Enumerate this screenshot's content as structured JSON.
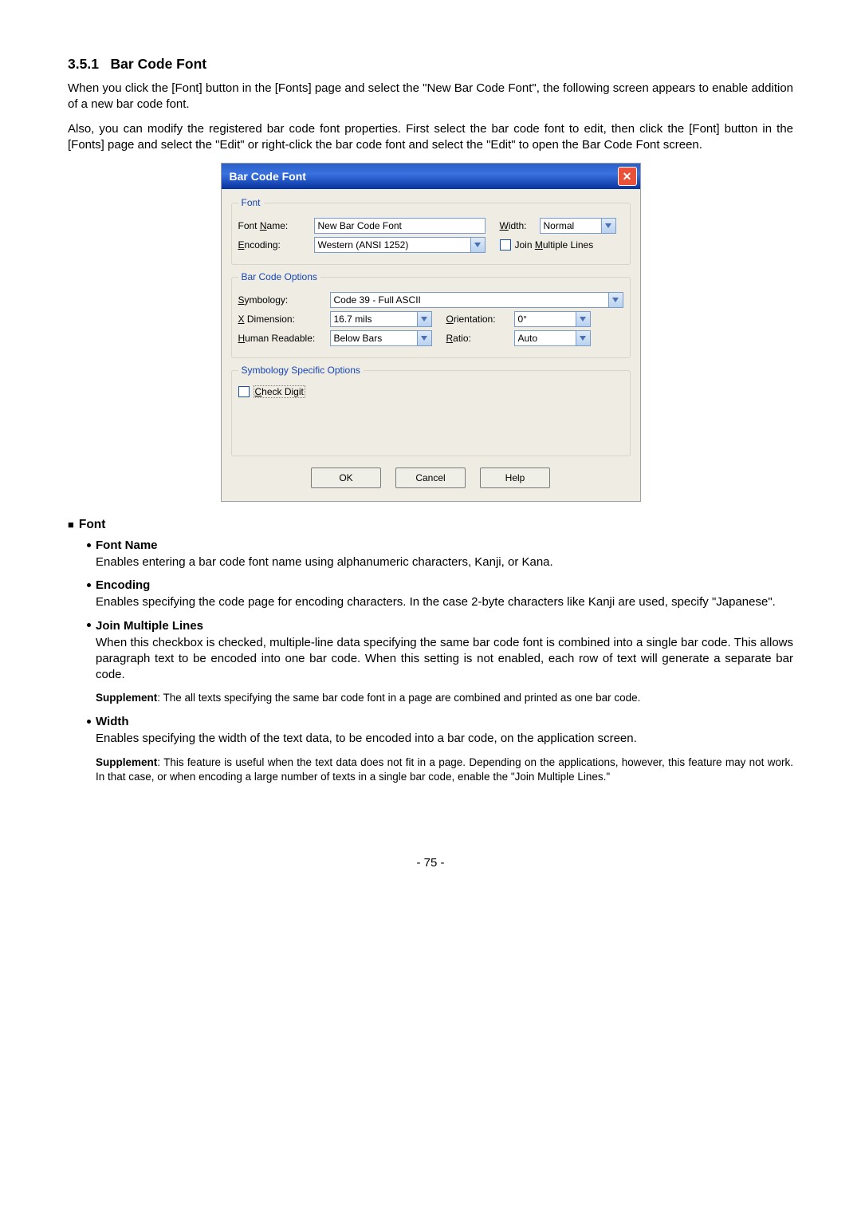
{
  "section_number": "3.5.1",
  "section_title": "Bar Code Font",
  "intro_p1": "When you click the [Font] button in the [Fonts] page and select the \"New Bar Code Font\", the following screen appears to enable addition of a new bar code font.",
  "intro_p2": "Also, you can modify the registered bar code font properties.   First select the bar code font to edit, then click the [Font] button in the [Fonts] page and select the \"Edit\" or right-click the bar code font and select the \"Edit\" to open the Bar Code Font screen.",
  "dialog": {
    "title": "Bar Code Font",
    "group_font_legend": "Font",
    "font_name_lbl_pre": "Font ",
    "font_name_lbl_u": "N",
    "font_name_lbl_post": "ame:",
    "font_name_val": "New Bar Code Font",
    "width_lbl_u": "W",
    "width_lbl_post": "idth:",
    "width_val": "Normal",
    "encoding_lbl_u": "E",
    "encoding_lbl_post": "ncoding:",
    "encoding_val": "Western (ANSI 1252)",
    "join_lbl_pre": "Join ",
    "join_lbl_u": "M",
    "join_lbl_post": "ultiple Lines",
    "group_bco_legend": "Bar Code Options",
    "symb_lbl_u": "S",
    "symb_lbl_post": "ymbology:",
    "symb_val": "Code 39 - Full ASCII",
    "xdim_lbl_u": "X",
    "xdim_lbl_post": " Dimension:",
    "xdim_val": "16.7 mils",
    "orient_lbl_u": "O",
    "orient_lbl_post": "rientation:",
    "orient_val": "0°",
    "hr_lbl_u": "H",
    "hr_lbl_post": "uman Readable:",
    "hr_val": "Below Bars",
    "ratio_lbl_u": "R",
    "ratio_lbl_post": "atio:",
    "ratio_val": "Auto",
    "group_sso_legend": "Symbology Specific Options",
    "check_lbl_u": "C",
    "check_lbl_post": "heck Digit",
    "btn_ok": "OK",
    "btn_cancel": "Cancel",
    "btn_help": "Help"
  },
  "body": {
    "sect_font": "Font",
    "fn_hdr": "Font Name",
    "fn_txt": "Enables entering a bar code font name using alphanumeric characters, Kanji, or Kana.",
    "enc_hdr": "Encoding",
    "enc_txt": "Enables specifying the code page for encoding characters.  In the case 2-byte characters like Kanji are used, specify \"Japanese\".",
    "jml_hdr": "Join Multiple Lines",
    "jml_txt": "When this checkbox is checked, multiple-line data specifying the same bar code font is combined into a single bar code.  This allows paragraph text to be encoded into one bar code.  When this setting is not enabled, each row of text will generate a separate bar code.",
    "jml_supp_lbl": "Supplement",
    "jml_supp_txt": ":   The all texts specifying the same bar code font in a page are combined and printed as one bar code.",
    "w_hdr": "Width",
    "w_txt": "Enables specifying the width of the text data, to be encoded into a bar code, on the application screen.",
    "w_supp_lbl": "Supplement",
    "w_supp_txt": ":  This feature is useful when the text data does not fit in a page.  Depending on the applications, however, this feature may not work.  In that case, or when encoding a large number of texts in a single bar code, enable the \"Join Multiple Lines.\""
  },
  "page_number": "- 75 -"
}
